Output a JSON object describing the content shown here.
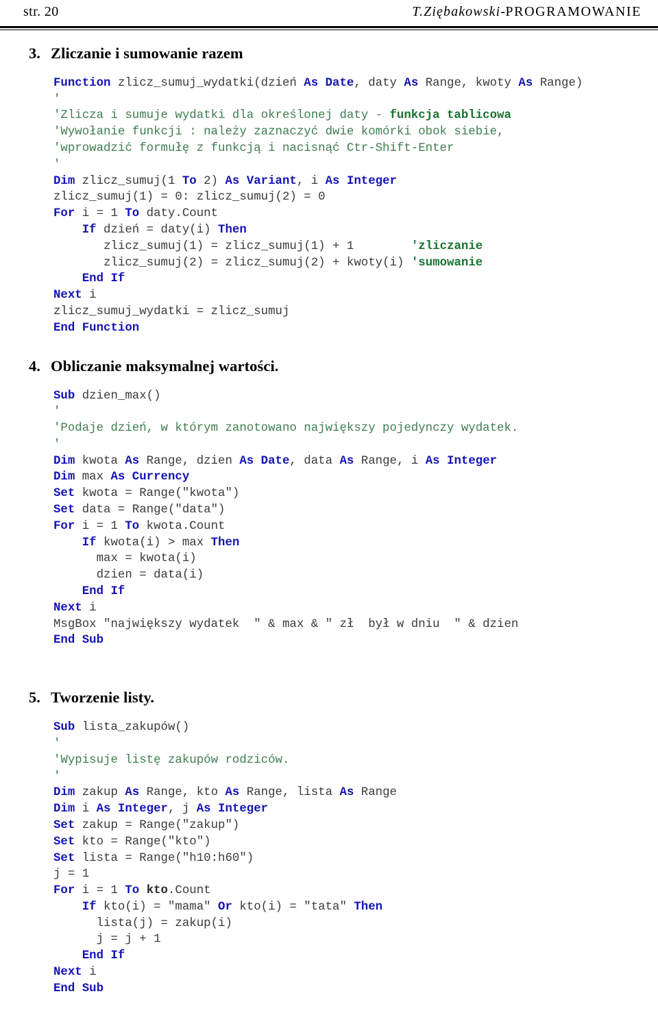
{
  "header": {
    "page_label": "str. 20",
    "author": "T.Ziębakowski",
    "separator": "-",
    "title": "PROGRAMOWANIE"
  },
  "sections": [
    {
      "number": "3.",
      "heading": "Zliczanie i sumowanie razem",
      "code_lines": [
        [
          {
            "t": "Function ",
            "s": "kw"
          },
          {
            "t": "zlicz_sumuj_wydatki(dzień ",
            "s": "tx"
          },
          {
            "t": "As Date",
            "s": "kw"
          },
          {
            "t": ", daty ",
            "s": "tx"
          },
          {
            "t": "As",
            "s": "kw"
          },
          {
            "t": " Range, kwoty ",
            "s": "tx"
          },
          {
            "t": "As",
            "s": "kw"
          },
          {
            "t": " Range)",
            "s": "tx"
          }
        ],
        [
          {
            "t": "'",
            "s": "cm"
          }
        ],
        [
          {
            "t": "'Zlicza i sumuje wydatki dla określonej daty - ",
            "s": "cm"
          },
          {
            "t": "funkcja tablicowa",
            "s": "cmb"
          }
        ],
        [
          {
            "t": "'Wywołanie funkcji : należy zaznaczyć dwie komórki obok siebie,",
            "s": "cm"
          }
        ],
        [
          {
            "t": "'wprowadzić formułę z funkcją i nacisnąć Ctr-Shift-Enter",
            "s": "cm"
          }
        ],
        [
          {
            "t": "'",
            "s": "cm"
          }
        ],
        [
          {
            "t": "Dim",
            "s": "kw"
          },
          {
            "t": " zlicz_sumuj(1 ",
            "s": "tx"
          },
          {
            "t": "To",
            "s": "kw"
          },
          {
            "t": " 2) ",
            "s": "tx"
          },
          {
            "t": "As Variant",
            "s": "kw"
          },
          {
            "t": ", i ",
            "s": "tx"
          },
          {
            "t": "As Integer",
            "s": "kw"
          }
        ],
        [
          {
            "t": "zlicz_sumuj(1) = 0: zlicz_sumuj(2) = 0",
            "s": "tx"
          }
        ],
        [
          {
            "t": "For",
            "s": "kw"
          },
          {
            "t": " i = 1 ",
            "s": "tx"
          },
          {
            "t": "To",
            "s": "kw"
          },
          {
            "t": " daty.Count",
            "s": "tx"
          }
        ],
        [
          {
            "t": "    ",
            "s": "tx"
          },
          {
            "t": "If",
            "s": "kw"
          },
          {
            "t": " dzień = daty(i) ",
            "s": "tx"
          },
          {
            "t": "Then",
            "s": "kw"
          }
        ],
        [
          {
            "t": "       zlicz_sumuj(1) = zlicz_sumuj(1) + 1        ",
            "s": "tx"
          },
          {
            "t": "'zliczanie",
            "s": "cmb"
          }
        ],
        [
          {
            "t": "       zlicz_sumuj(2) = zlicz_sumuj(2) + kwoty(i) ",
            "s": "tx"
          },
          {
            "t": "'sumowanie",
            "s": "cmb"
          }
        ],
        [
          {
            "t": "    ",
            "s": "tx"
          },
          {
            "t": "End If",
            "s": "kw"
          }
        ],
        [
          {
            "t": "Next",
            "s": "kw"
          },
          {
            "t": " i",
            "s": "tx"
          }
        ],
        [
          {
            "t": "zlicz_sumuj_wydatki = zlicz_sumuj",
            "s": "tx"
          }
        ],
        [
          {
            "t": "End Function",
            "s": "kw"
          }
        ]
      ]
    },
    {
      "number": "4.",
      "heading": "Obliczanie maksymalnej wartości.",
      "code_lines": [
        [
          {
            "t": "Sub",
            "s": "kw"
          },
          {
            "t": " dzien_max()",
            "s": "tx"
          }
        ],
        [
          {
            "t": "'",
            "s": "cm"
          }
        ],
        [
          {
            "t": "'Podaje dzień, w którym zanotowano największy pojedynczy wydatek.",
            "s": "cm"
          }
        ],
        [
          {
            "t": "'",
            "s": "cm"
          }
        ],
        [
          {
            "t": "Dim",
            "s": "kw"
          },
          {
            "t": " kwota ",
            "s": "tx"
          },
          {
            "t": "As",
            "s": "kw"
          },
          {
            "t": " Range, dzien ",
            "s": "tx"
          },
          {
            "t": "As Date",
            "s": "kw"
          },
          {
            "t": ", data ",
            "s": "tx"
          },
          {
            "t": "As",
            "s": "kw"
          },
          {
            "t": " Range, i ",
            "s": "tx"
          },
          {
            "t": "As Integer",
            "s": "kw"
          }
        ],
        [
          {
            "t": "Dim",
            "s": "kw"
          },
          {
            "t": " max ",
            "s": "tx"
          },
          {
            "t": "As Currency",
            "s": "kw"
          }
        ],
        [
          {
            "t": "Set",
            "s": "kw"
          },
          {
            "t": " kwota = Range(\"kwota\")",
            "s": "tx"
          }
        ],
        [
          {
            "t": "Set",
            "s": "kw"
          },
          {
            "t": " data = Range(\"data\")",
            "s": "tx"
          }
        ],
        [
          {
            "t": "For",
            "s": "kw"
          },
          {
            "t": " i = 1 ",
            "s": "tx"
          },
          {
            "t": "To",
            "s": "kw"
          },
          {
            "t": " kwota.Count",
            "s": "tx"
          }
        ],
        [
          {
            "t": "    ",
            "s": "tx"
          },
          {
            "t": "If",
            "s": "kw"
          },
          {
            "t": " kwota(i) > max ",
            "s": "tx"
          },
          {
            "t": "Then",
            "s": "kw"
          }
        ],
        [
          {
            "t": "      max = kwota(i)",
            "s": "tx"
          }
        ],
        [
          {
            "t": "      dzien = data(i)",
            "s": "tx"
          }
        ],
        [
          {
            "t": "    ",
            "s": "tx"
          },
          {
            "t": "End If",
            "s": "kw"
          }
        ],
        [
          {
            "t": "Next",
            "s": "kw"
          },
          {
            "t": " i",
            "s": "tx"
          }
        ],
        [
          {
            "t": "MsgBox \"największy wydatek  \" & max & \" zł  był w dniu  \" & dzien",
            "s": "tx"
          }
        ],
        [
          {
            "t": "End Sub",
            "s": "kw"
          }
        ]
      ]
    },
    {
      "number": "5.",
      "heading": "Tworzenie listy.",
      "code_lines": [
        [
          {
            "t": "Sub",
            "s": "kw"
          },
          {
            "t": " lista_zakupów()",
            "s": "tx"
          }
        ],
        [
          {
            "t": "'",
            "s": "cm"
          }
        ],
        [
          {
            "t": "'Wypisuje listę zakupów rodziców.",
            "s": "cm"
          }
        ],
        [
          {
            "t": "'",
            "s": "cm"
          }
        ],
        [
          {
            "t": "Dim",
            "s": "kw"
          },
          {
            "t": " zakup ",
            "s": "tx"
          },
          {
            "t": "As",
            "s": "kw"
          },
          {
            "t": " Range, kto ",
            "s": "tx"
          },
          {
            "t": "As",
            "s": "kw"
          },
          {
            "t": " Range, lista ",
            "s": "tx"
          },
          {
            "t": "As",
            "s": "kw"
          },
          {
            "t": " Range",
            "s": "tx"
          }
        ],
        [
          {
            "t": "Dim",
            "s": "kw"
          },
          {
            "t": " i ",
            "s": "tx"
          },
          {
            "t": "As Integer",
            "s": "kw"
          },
          {
            "t": ", j ",
            "s": "tx"
          },
          {
            "t": "As Integer",
            "s": "kw"
          }
        ],
        [
          {
            "t": "Set",
            "s": "kw"
          },
          {
            "t": " zakup = Range(\"zakup\")",
            "s": "tx"
          }
        ],
        [
          {
            "t": "Set",
            "s": "kw"
          },
          {
            "t": " kto = Range(\"kto\")",
            "s": "tx"
          }
        ],
        [
          {
            "t": "Set",
            "s": "kw"
          },
          {
            "t": " lista = Range(\"h10:h60\")",
            "s": "tx"
          }
        ],
        [
          {
            "t": "j = 1",
            "s": "tx"
          }
        ],
        [
          {
            "t": "For",
            "s": "kw"
          },
          {
            "t": " i = 1 ",
            "s": "tx"
          },
          {
            "t": "To ",
            "s": "kw"
          },
          {
            "t": "kto",
            "s": "bk"
          },
          {
            "t": ".Count",
            "s": "tx"
          }
        ],
        [
          {
            "t": "    ",
            "s": "tx"
          },
          {
            "t": "If",
            "s": "kw"
          },
          {
            "t": " kto(i) = \"mama\" ",
            "s": "tx"
          },
          {
            "t": "Or",
            "s": "kw"
          },
          {
            "t": " kto(i) = \"tata\" ",
            "s": "tx"
          },
          {
            "t": "Then",
            "s": "kw"
          }
        ],
        [
          {
            "t": "      lista(j) = zakup(i)",
            "s": "tx"
          }
        ],
        [
          {
            "t": "      j = j + 1",
            "s": "tx"
          }
        ],
        [
          {
            "t": "    ",
            "s": "tx"
          },
          {
            "t": "End If",
            "s": "kw"
          }
        ],
        [
          {
            "t": "Next",
            "s": "kw"
          },
          {
            "t": " i",
            "s": "tx"
          }
        ],
        [
          {
            "t": "End Sub",
            "s": "kw"
          }
        ]
      ]
    }
  ]
}
